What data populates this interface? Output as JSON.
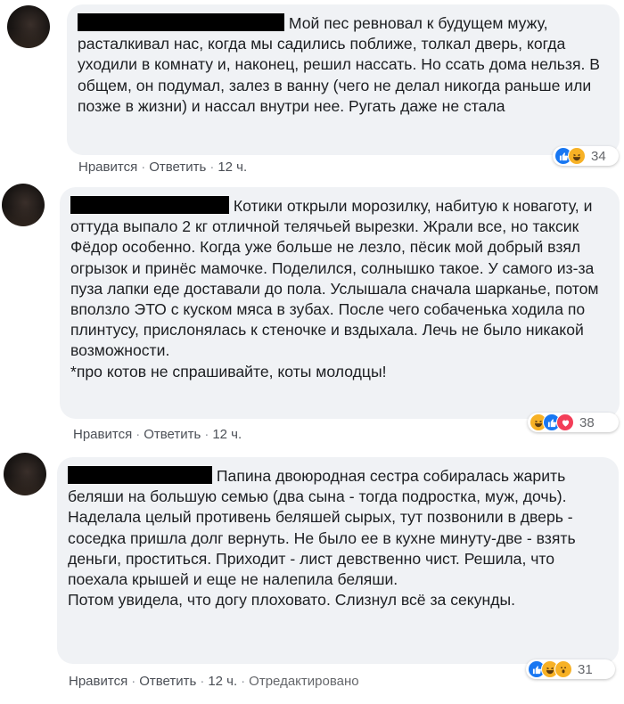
{
  "comments": [
    {
      "text": "Мой пес ревновал к будущем мужу, расталкивал нас, когда мы садились поближе, толкал дверь, когда уходили в комнату и, наконец, решил нассать. Но ссать дома нельзя. В общем, он подумал, залез в ванну (чего не делал никогда раньше или позже в жизни) и нассал внутри нее. Ругать даже не стала",
      "like": "Нравится",
      "reply": "Ответить",
      "time": "12 ч.",
      "reactions": [
        "like",
        "haha"
      ],
      "count": "34"
    },
    {
      "text": "Котики открыли морозилку, набитую к новаготу, и оттуда выпало 2 кг отличной телячьей вырезки. Жрали все, но таксик Фёдор особенно. Когда уже больше не лезло, пёсик мой добрый взял огрызок и принёс мамочке. Поделился, солнышко такое. У самого из-за пуза лапки еде доставали до пола. Услышала сначала шарканье, потом вползло ЭТО с куском мяса в зубах. После чего собаченька ходила по плинтусу, прислонялась к стеночке и вздыхала. Лечь не было никакой возможности.\n*про котов не спрашивайте, коты молодцы!",
      "like": "Нравится",
      "reply": "Ответить",
      "time": "12 ч.",
      "reactions": [
        "haha",
        "like",
        "love"
      ],
      "count": "38"
    },
    {
      "text": "Папина двоюродная сестра собиралась жарить беляши на большую семью (два сына - тогда подростка, муж, дочь).\nНаделала целый противень беляшей сырых, тут позвонили в дверь - соседка пришла долг вернуть. Не было ее в кухне минуту-две - взять деньги, проститься. Приходит - лист девственно чист. Решила, что поехала крышей и еще не налепила беляши.\nПотом увидела, что догу плоховато. Слизнул всё за секунды.",
      "like": "Нравится",
      "reply": "Ответить",
      "time": "12 ч.",
      "edited": "Отредактировано",
      "reactions": [
        "like",
        "haha",
        "wow"
      ],
      "count": "31"
    }
  ]
}
